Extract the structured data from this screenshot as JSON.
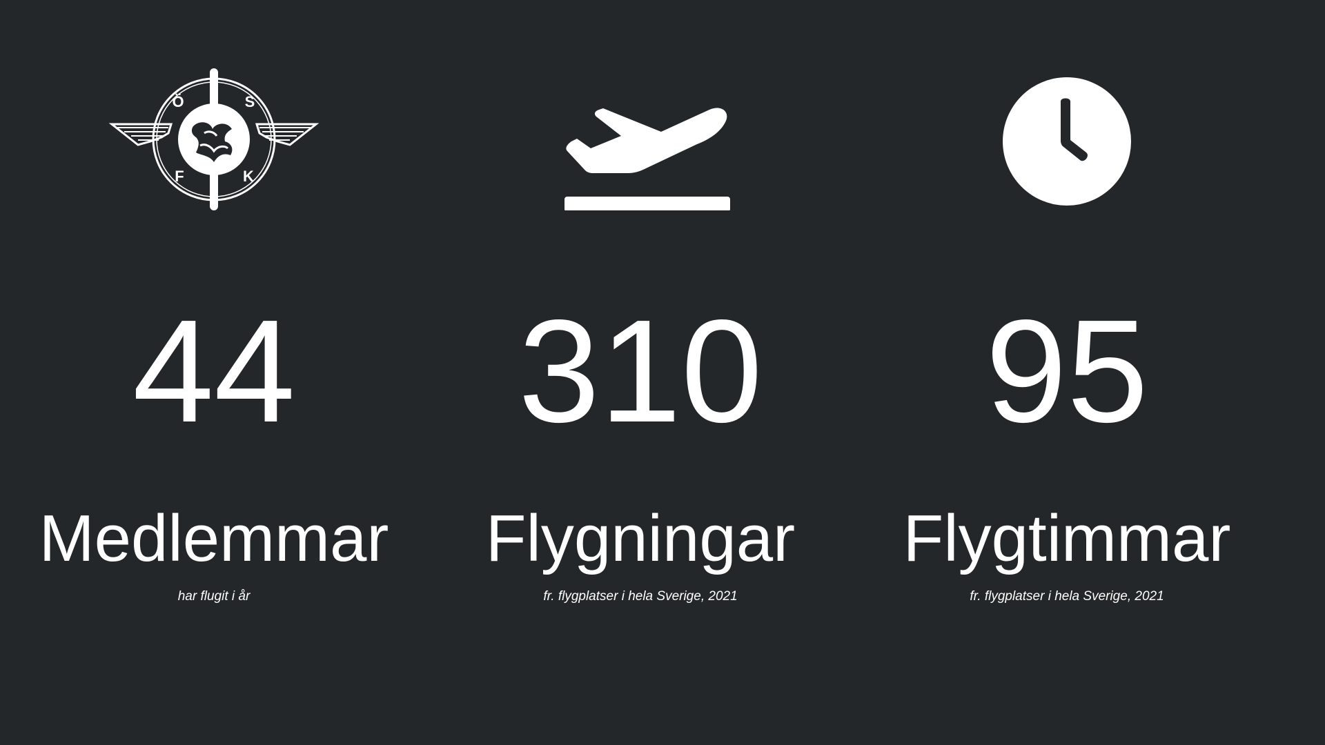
{
  "colors": {
    "background": "#232729",
    "foreground": "#ffffff"
  },
  "stats": [
    {
      "icon": "club-logo-icon",
      "logo_text": "ÖSFK",
      "value": "44",
      "label": "Medlemmar",
      "caption": "har flugit i år"
    },
    {
      "icon": "airplane-takeoff-icon",
      "value": "310",
      "label": "Flygningar",
      "caption": "fr. flygplatser i hela Sverige, 2021"
    },
    {
      "icon": "clock-icon",
      "value": "95",
      "label": "Flygtimmar",
      "caption": "fr. flygplatser i hela Sverige, 2021"
    }
  ]
}
